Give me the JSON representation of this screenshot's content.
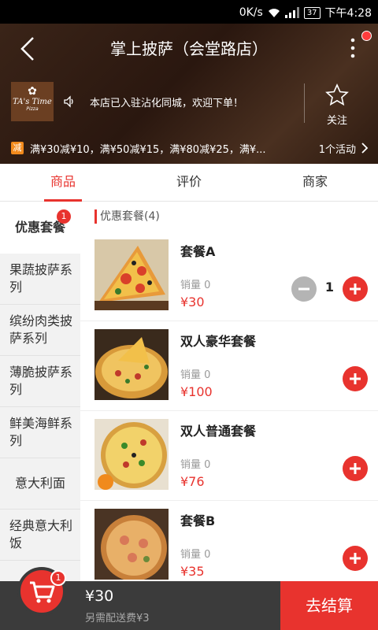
{
  "status_bar": {
    "network": "0K/s",
    "battery": "37",
    "time": "下午4:28"
  },
  "header": {
    "title": "掌上披萨（会堂路店）"
  },
  "shop": {
    "logo_text_1": "TA's Time",
    "logo_text_2": "Pizza",
    "notice": "本店已入驻沾化同城，欢迎下单！",
    "follow_label": "关注",
    "promo_badge": "减",
    "promo_text": "满¥30减¥10，满¥50减¥15，满¥80减¥25，满¥...",
    "activity_count": "1个活动"
  },
  "tabs": [
    {
      "label": "商品"
    },
    {
      "label": "评价"
    },
    {
      "label": "商家"
    }
  ],
  "sidebar": {
    "items": [
      {
        "label": "优惠套餐",
        "badge": "1"
      },
      {
        "label": "果蔬披萨系列"
      },
      {
        "label": "缤纷肉类披萨系列"
      },
      {
        "label": "薄脆披萨系列"
      },
      {
        "label": "鲜美海鲜系列"
      },
      {
        "label": "意大利面"
      },
      {
        "label": "经典意大利饭"
      }
    ]
  },
  "section": {
    "title": "优惠套餐(4)"
  },
  "products": [
    {
      "name": "套餐A",
      "sold": "销量 0",
      "price": "¥30",
      "qty": "1"
    },
    {
      "name": "双人豪华套餐",
      "sold": "销量 0",
      "price": "¥100"
    },
    {
      "name": "双人普通套餐",
      "sold": "销量 0",
      "price": "¥76"
    },
    {
      "name": "套餐B",
      "sold": "销量 0",
      "price": "¥35"
    }
  ],
  "cart": {
    "badge": "1",
    "total": "¥30",
    "delivery_note": "另需配送费¥3",
    "checkout_label": "去结算"
  },
  "colors": {
    "accent": "#e8332e",
    "header_bg": "#3a2418",
    "bottom_bar": "#3b3b3b",
    "promo_badge": "#f28a1c"
  }
}
